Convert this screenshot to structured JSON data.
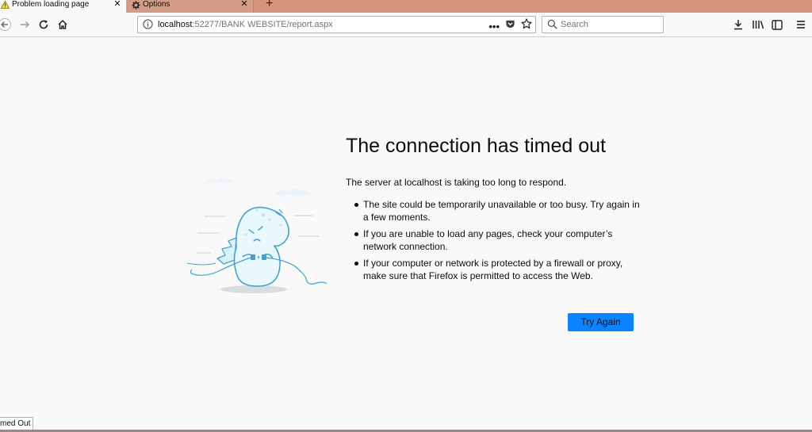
{
  "tabs": [
    {
      "label": "Problem loading page",
      "icon": "warning-icon",
      "active": true
    },
    {
      "label": "Options",
      "icon": "gear-icon",
      "active": false
    }
  ],
  "urlbar": {
    "host": "localhost",
    "path": ":52277/BANK WEBSITE/report.aspx"
  },
  "search": {
    "placeholder": "Search"
  },
  "error": {
    "title": "The connection has timed out",
    "description": "The server at localhost is taking too long to respond.",
    "bullets": [
      "The site could be temporarily unavailable or too busy. Try again in a few moments.",
      "If you are unable to load any pages, check your computer’s network connection.",
      "If your computer or network is protected by a firewall or proxy, make sure that Firefox is permitted to access the Web."
    ],
    "try_again_label": "Try Again"
  },
  "status": {
    "text": "med Out"
  },
  "colors": {
    "tabstrip": "#d7937b",
    "accent": "#0a84ff",
    "background": "#f9f9fa"
  }
}
